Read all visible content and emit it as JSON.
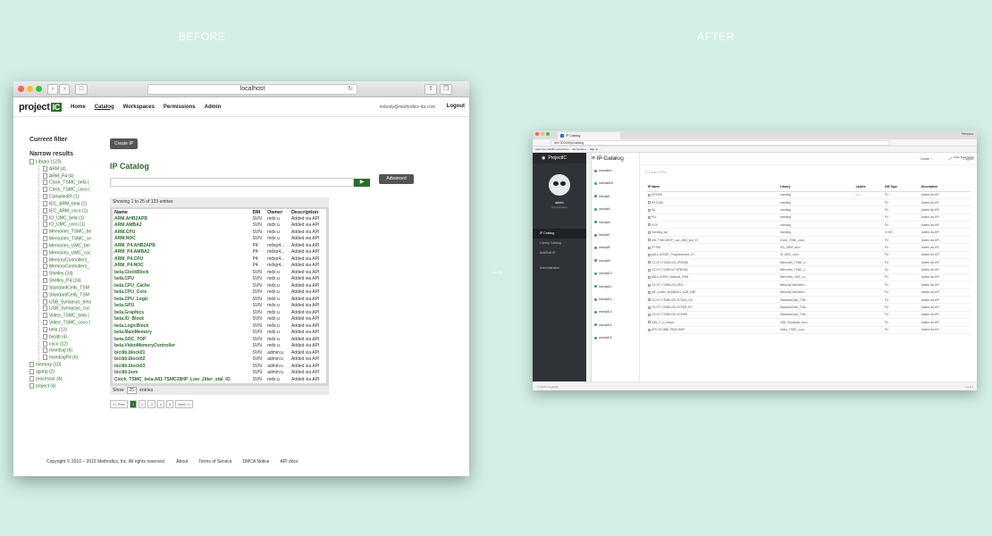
{
  "labels": {
    "before": "BEFORE",
    "after": "AFTER",
    "arrow": "→"
  },
  "before": {
    "browser": {
      "url": "localhost",
      "reload_icon": "reload-icon"
    },
    "header": {
      "logo": "project",
      "logo_suffix": "IC",
      "nav": [
        "Home",
        "Catalog",
        "Workspaces",
        "Permissions",
        "Admin"
      ],
      "user": "nobody@methodics-da.com",
      "logout": "Logout"
    },
    "filter": {
      "current": "Current filter",
      "narrow": "Narrow results",
      "root": "Library (123)",
      "children": [
        "ARM (4)",
        "ARM_P4 (4)",
        "Clock_TSMC_bela (",
        "Clock_TSMC_coco (",
        "CompiledIP (1)",
        "IEC_ARM_bela (1)",
        "IEC_ARM_coco (1)",
        "IO_UMC_bela (1)",
        "IO_UMC_coco (1)",
        "Memories_TSMC_be",
        "Memories_TSMC_co",
        "Memories_UMC_bel",
        "Memories_UMC_coc",
        "MemoryControllers_",
        "MemoryControllers_",
        "Shelley (24)",
        "Shelley_P4 (24)",
        "StandardCells_TSM",
        "StandardCells_TSM",
        "USB_Synopsys_bela",
        "USB_Synopsys_coc",
        "Video_TSMC_bela (",
        "Video_TSMC_coco (",
        "bela (12)",
        "bicilib (4)",
        "coco (12)",
        "mxedsig (6)",
        "mxedsigP4 (6)"
      ],
      "others": [
        "memory (10)",
        "qpimp (2)",
        "processor (4)",
        "project (4)"
      ]
    },
    "main": {
      "create_button": "Create IP",
      "title": "IP Catalog",
      "go_button": "▶",
      "advanced_button": "Advanced",
      "status": "Showing 1 to 25 of 123 entries",
      "columns": [
        "Name",
        "DM",
        "Owner",
        "Description"
      ],
      "rows": [
        [
          "ARM.AHB2APB",
          "SVN",
          "mdx:u",
          "Added via API"
        ],
        [
          "ARM.AMBA2",
          "SVN",
          "mdx:u",
          "Added via API"
        ],
        [
          "ARM.CPU",
          "SVN",
          "mdx:u",
          "Added via API"
        ],
        [
          "ARM.NOC",
          "SVN",
          "mdx:u",
          "Added via API"
        ],
        [
          "ARM_P4.AHB2APB",
          "P4",
          "mdxp4...",
          "Added via API"
        ],
        [
          "ARM_P4.AMBA2",
          "P4",
          "mdxp4...",
          "Added via API"
        ],
        [
          "ARM_P4.CPU",
          "P4",
          "mdxp4...",
          "Added via API"
        ],
        [
          "ARM_P4.NOC",
          "P4",
          "mdxp4...",
          "Added via API"
        ],
        [
          "bela.ClockBlock",
          "SVN",
          "mdx:u",
          "Added via API"
        ],
        [
          "bela.CPU",
          "SVN",
          "mdx:u",
          "Added via API"
        ],
        [
          "bela.CPU_Cache",
          "SVN",
          "mdx:u",
          "Added via API"
        ],
        [
          "bela.CPU_Core",
          "SVN",
          "mdx:u",
          "Added via API"
        ],
        [
          "bela.CPU_Logic",
          "SVN",
          "mdx:u",
          "Added via API"
        ],
        [
          "bela.GPU",
          "SVN",
          "mdx:u",
          "Added via API"
        ],
        [
          "bela.Graphics",
          "SVN",
          "mdx:u",
          "Added via API"
        ],
        [
          "bela.IO_Block",
          "SVN",
          "mdx:u",
          "Added via API"
        ],
        [
          "bela.LogicBlock",
          "SVN",
          "mdx:u",
          "Added via API"
        ],
        [
          "bela.MainMemory",
          "SVN",
          "mdx:u",
          "Added via API"
        ],
        [
          "bela.SOC_TOP",
          "SVN",
          "mdx:u",
          "Added via API"
        ],
        [
          "bela.VideoMemoryController",
          "SVN",
          "mdx:u",
          "Added via API"
        ],
        [
          "bicilib.block01",
          "SVN",
          "admin:u",
          "Added via API"
        ],
        [
          "bicilib.block02",
          "SVN",
          "admin:u",
          "Added via API"
        ],
        [
          "bicilib.block03",
          "SVN",
          "admin:u",
          "Added via API"
        ],
        [
          "bicilib.bom",
          "SVN",
          "admin:u",
          "Added via API"
        ],
        [
          "Clock_TSMC_bela.A81-TSMC28HP_Low_Jitter_xtal_IO",
          "SVN",
          "mdx:u",
          "Added via API"
        ]
      ],
      "show_label": "Show",
      "show_value": "25",
      "entries_label": "entries",
      "pager": [
        "<< Prev",
        "1",
        "2",
        "3",
        "4",
        "5",
        "Next >>"
      ]
    },
    "footer": [
      "Copyright © 2010 – 2016 Methodics, Inc. All rights reserved.",
      "About",
      "Terms of Service",
      "DMCA Notice",
      "API docs"
    ]
  },
  "after": {
    "browser": {
      "tab": "IP Catalog",
      "persona": "Persona",
      "url": "dev:3000/#/ip/catalog",
      "bookmarks": "Apps  dev  Netflix  Lionel  Free  ...  Momentum  ...  Sign In  ...",
      "other_bookmarks": "Other Bookmarks"
    },
    "sidebar": {
      "brand": "ProjectIC",
      "username": "admin",
      "userrole": "Administrator",
      "nav": [
        "IP Catalog",
        "Library Catalog",
        "Add/Edit IP",
        "Administration"
      ]
    },
    "labels_panel": {
      "search": "Search Labels",
      "filter_strip": "Filter by Labels",
      "labels": [
        "mxedlabel",
        "mxedlabel2",
        "mxedpll1",
        "mxedpll4",
        "mxedpll4",
        "mxedpll7",
        "mxedpll9",
        "mxedpll9",
        "mxedpll10",
        "mxedpll11",
        "mxedpll12",
        "mxedpll13",
        "mxedpll14",
        "mxedpll15"
      ],
      "note": "HTML is great for declaring static documents, but it falters when we try to"
    },
    "main": {
      "title": "IP Catalog",
      "create": "Create +",
      "logout": "Logout",
      "search": "Search IPs",
      "columns": [
        "IP Name",
        "Library",
        "Labels",
        "DM Type",
        "Description"
      ],
      "rows": [
        [
          "GPIO8P",
          "mxedsig",
          "• • •",
          "P4",
          "Added via API"
        ],
        [
          "RSTUDD",
          "mxedsig",
          "",
          "P4",
          "Added via API"
        ],
        [
          "i2s",
          "mxedsig",
          "",
          "P4",
          "Added via API"
        ],
        [
          "PLL",
          "mxedsig",
          "",
          "P4",
          "Added via API"
        ],
        [
          "VGA",
          "mxedsig",
          "",
          "P4",
          "Added via API"
        ],
        [
          "mxedsig_top",
          "mxedsig",
          "",
          "CONT",
          "Added via API"
        ],
        [
          "A81-TSMC28HP_Low_Jitter_xtal_IO",
          "Clock_TSMC_coco",
          "",
          "P4",
          "Added via API"
        ],
        [
          "SYT58",
          "IEC_ARM_coco",
          "",
          "P4",
          "Added via API"
        ],
        [
          "A81U-U200IP_Programmable_IO",
          "IO_UMC_coco",
          "",
          "P4",
          "Added via API"
        ],
        [
          "CS-DTI-TS28N-GS-1P5RAM",
          "Memories_TSMC_c...",
          "",
          "P4",
          "Added via API"
        ],
        [
          "CS-DTI-TS28N-LP-1P5RAM",
          "Memories_TSMC_c...",
          "",
          "P4",
          "Added via API"
        ],
        [
          "A81U-U2800_Multiport_RAM",
          "Memories_UMC_co...",
          "",
          "P4",
          "Added via API"
        ],
        [
          "CS-DTI-TS28N-GS-REG...",
          "MemoryControllers...",
          "",
          "P4",
          "Added via API"
        ],
        [
          "ddr_combo_ts28hpm12_ts28_t28b",
          "MemoryControllers...",
          "",
          "P4",
          "Added via API"
        ],
        [
          "CS-DTI-TS28N-GS-SCDAN_GO",
          "StandardCells_TSM...",
          "",
          "P4",
          "Added via API"
        ],
        [
          "CS-DTI-TS28N-GS-SCPDB_PO",
          "StandardCells_TSM...",
          "",
          "P4",
          "Added via API"
        ],
        [
          "CS-DTI-TS28N-GS-SCPWR",
          "StandardCells_TSM...",
          "",
          "P4",
          "Added via API"
        ],
        [
          "USB_2_0_Device",
          "USB_Synopsys_coco",
          "",
          "P4",
          "Added via API"
        ],
        [
          "AFE-19-16Bit-TSMC28HP",
          "Video_TSMC_coco",
          "",
          "P4",
          "Added via API"
        ]
      ]
    },
    "footer": {
      "copyright": "© 2016 Copyright",
      "version": "v.0.0.1"
    }
  }
}
